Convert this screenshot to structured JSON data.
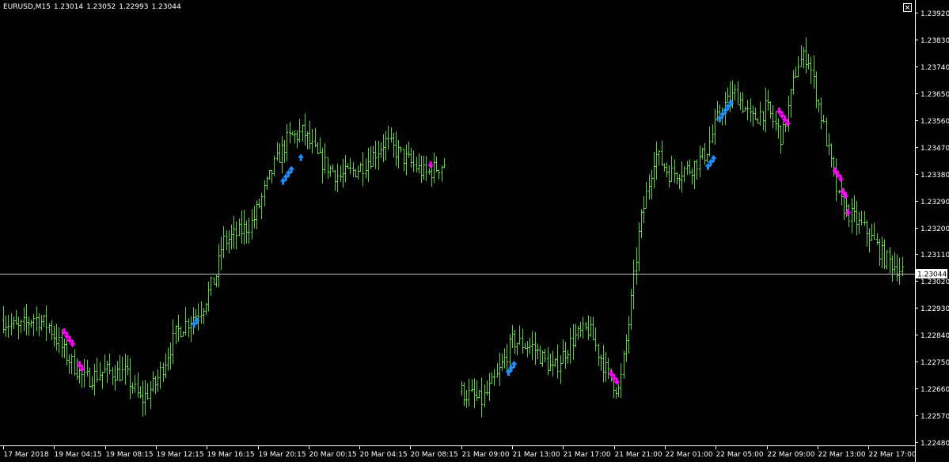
{
  "window": {
    "symbol": "EURUSD,M15",
    "ohlc": [
      "1.23014",
      "1.23052",
      "1.22993",
      "1.23044"
    ]
  },
  "colors": {
    "background": "#000000",
    "bar": "#5fd140",
    "up_arrow": "#1e90ff",
    "down_arrow": "#ff00ff",
    "axis": "#ffffff",
    "price_line": "#c0c0c0"
  },
  "chart_data": {
    "type": "ohlc",
    "symbol": "EURUSD",
    "timeframe": "M15",
    "ylim": [
      1.2248,
      1.2392
    ],
    "y_ticks": [
      "1.23920",
      "1.23830",
      "1.23740",
      "1.23650",
      "1.23560",
      "1.23470",
      "1.23380",
      "1.23290",
      "1.23200",
      "1.23110",
      "1.23020",
      "1.22930",
      "1.22840",
      "1.22750",
      "1.22660",
      "1.22570",
      "1.22480"
    ],
    "current_price": "1.23044",
    "x_tick_labels": [
      "17 Mar 2018",
      "19 Mar 04:15",
      "19 Mar 08:15",
      "19 Mar 12:15",
      "19 Mar 16:15",
      "19 Mar 20:15",
      "20 Mar 00:15",
      "20 Mar 04:15",
      "20 Mar 08:15",
      "21 Mar 09:00",
      "21 Mar 13:00",
      "21 Mar 17:00",
      "21 Mar 21:00",
      "22 Mar 01:00",
      "22 Mar 05:00",
      "22 Mar 09:00",
      "22 Mar 13:00",
      "22 Mar 17:00"
    ],
    "segments": [
      {
        "start_tick": 0,
        "end_tick": 8.7,
        "anchors": [
          [
            0,
            1.2289
          ],
          [
            0.3,
            1.2286
          ],
          [
            0.6,
            1.229
          ],
          [
            0.9,
            1.2287
          ],
          [
            1.2,
            1.2278
          ],
          [
            1.6,
            1.2269
          ],
          [
            2.0,
            1.2272
          ],
          [
            2.4,
            1.2271
          ],
          [
            2.7,
            1.2262
          ],
          [
            3.0,
            1.2268
          ],
          [
            3.4,
            1.2285
          ],
          [
            3.9,
            1.2293
          ],
          [
            4.2,
            1.2305
          ],
          [
            4.3,
            1.2315
          ],
          [
            4.6,
            1.2318
          ],
          [
            4.9,
            1.2322
          ],
          [
            5.3,
            1.234
          ],
          [
            5.6,
            1.235
          ],
          [
            5.9,
            1.2352
          ],
          [
            6.2,
            1.2343
          ],
          [
            6.6,
            1.2337
          ],
          [
            7.0,
            1.234
          ],
          [
            7.3,
            1.2345
          ],
          [
            7.5,
            1.2349
          ],
          [
            7.9,
            1.2343
          ],
          [
            8.3,
            1.2338
          ],
          [
            8.7,
            1.2342
          ]
        ]
      },
      {
        "start_tick": 9,
        "end_tick": 17.7,
        "anchors": [
          [
            9.0,
            1.2265
          ],
          [
            9.4,
            1.2262
          ],
          [
            9.7,
            1.227
          ],
          [
            10.0,
            1.2282
          ],
          [
            10.4,
            1.228
          ],
          [
            10.8,
            1.2272
          ],
          [
            11.2,
            1.2283
          ],
          [
            11.5,
            1.2286
          ],
          [
            11.9,
            1.227
          ],
          [
            12.1,
            1.2265
          ],
          [
            12.3,
            1.229
          ],
          [
            12.5,
            1.232
          ],
          [
            12.8,
            1.2345
          ],
          [
            13.1,
            1.2338
          ],
          [
            13.5,
            1.234
          ],
          [
            13.8,
            1.2345
          ],
          [
            14.1,
            1.236
          ],
          [
            14.4,
            1.2365
          ],
          [
            14.7,
            1.2356
          ],
          [
            15.0,
            1.236
          ],
          [
            15.3,
            1.235
          ],
          [
            15.6,
            1.2375
          ],
          [
            15.8,
            1.2378
          ],
          [
            16.1,
            1.2355
          ],
          [
            16.4,
            1.233
          ],
          [
            16.6,
            1.2325
          ],
          [
            17.0,
            1.2318
          ],
          [
            17.3,
            1.231
          ],
          [
            17.7,
            1.2305
          ]
        ]
      }
    ],
    "up_arrow_groups": [
      {
        "tick": 3.75,
        "price": 1.229,
        "count": 2
      },
      {
        "tick": 5.5,
        "price": 1.2338,
        "count": 4
      },
      {
        "tick": 5.85,
        "price": 1.2346,
        "count": 1
      },
      {
        "tick": 9.93,
        "price": 1.2274,
        "count": 3
      },
      {
        "tick": 13.85,
        "price": 1.2343,
        "count": 3
      },
      {
        "tick": 14.08,
        "price": 1.2359,
        "count": 5
      }
    ],
    "down_arrow_groups": [
      {
        "tick": 1.2,
        "price": 1.2283,
        "count": 4
      },
      {
        "tick": 1.5,
        "price": 1.2272,
        "count": 2
      },
      {
        "tick": 8.4,
        "price": 1.2339,
        "count": 1
      },
      {
        "tick": 11.95,
        "price": 1.2269,
        "count": 3
      },
      {
        "tick": 15.25,
        "price": 1.2357,
        "count": 4
      },
      {
        "tick": 16.35,
        "price": 1.2337,
        "count": 3
      },
      {
        "tick": 16.5,
        "price": 1.233,
        "count": 2
      },
      {
        "tick": 16.6,
        "price": 1.2323,
        "count": 1
      }
    ]
  }
}
